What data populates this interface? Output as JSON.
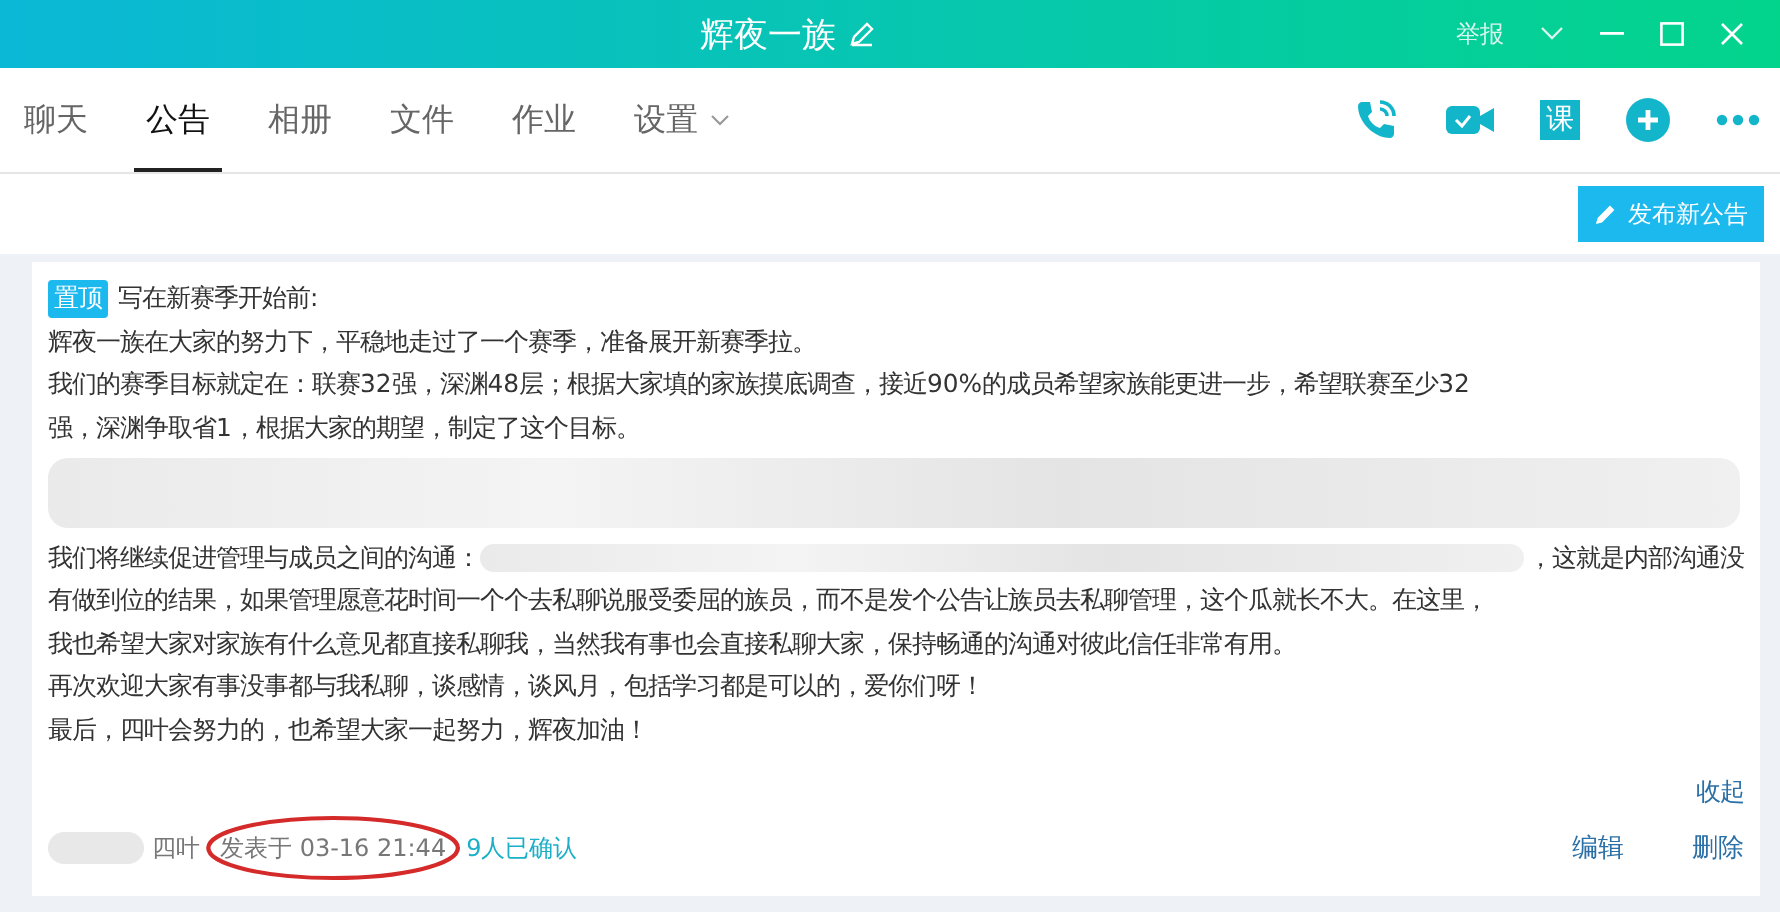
{
  "window": {
    "title": "辉夜一族",
    "report": "举报"
  },
  "tabs": [
    {
      "label": "聊天",
      "selected": false,
      "dropdown": false
    },
    {
      "label": "公告",
      "selected": true,
      "dropdown": false
    },
    {
      "label": "相册",
      "selected": false,
      "dropdown": false
    },
    {
      "label": "文件",
      "selected": false,
      "dropdown": false
    },
    {
      "label": "作业",
      "selected": false,
      "dropdown": false
    },
    {
      "label": "设置",
      "selected": false,
      "dropdown": true
    }
  ],
  "toolbar": [
    {
      "kind": "phone"
    },
    {
      "kind": "video"
    },
    {
      "kind": "course",
      "text": "课"
    },
    {
      "kind": "add"
    },
    {
      "kind": "more"
    }
  ],
  "publish_button": "发布新公告",
  "notice": {
    "pinned_badge": "置顶",
    "title": "写在新赛季开始前:",
    "lines": [
      [
        {
          "kind": "text",
          "text": "辉夜一族在大家的努力下，平稳地走过了一个赛季，准备展开新赛季拉。"
        }
      ],
      [
        {
          "kind": "text",
          "text": "我们的赛季目标就定在：联赛32强，深渊48层；根据大家填的家族摸底调查，接近90%的成员希望家族能更进一步，希望联赛至少32"
        }
      ],
      [
        {
          "kind": "text",
          "text": "强，深渊争取省1，根据大家的期望，制定了这个目标。"
        }
      ],
      [
        {
          "kind": "redacted"
        }
      ],
      [
        {
          "kind": "text",
          "text": "我们将继续促进管理与成员之间的沟通："
        },
        {
          "kind": "redacted"
        },
        {
          "kind": "text",
          "text": "，这就是内部沟通没"
        }
      ],
      [
        {
          "kind": "text",
          "text": "有做到位的结果，如果管理愿意花时间一个个去私聊说服受委屈的族员，而不是发个公告让族员去私聊管理，这个瓜就长不大。在这里，"
        }
      ],
      [
        {
          "kind": "text",
          "text": "我也希望大家对家族有什么意见都直接私聊我，当然我有事也会直接私聊大家，保持畅通的沟通对彼此信任非常有用。"
        }
      ],
      [
        {
          "kind": "text",
          "text": "再次欢迎大家有事没事都与我私聊，谈感情，谈风月，包括学习都是可以的，爱你们呀！"
        }
      ],
      [
        {
          "kind": "text",
          "text": "最后，四叶会努力的，也希望大家一起努力，辉夜加油！"
        }
      ]
    ],
    "collapse": "收起",
    "author": "四叶",
    "posted": "发表于 03-16 21:44",
    "confirmed": "9人已确认",
    "actions": [
      "编辑",
      "删除"
    ]
  }
}
